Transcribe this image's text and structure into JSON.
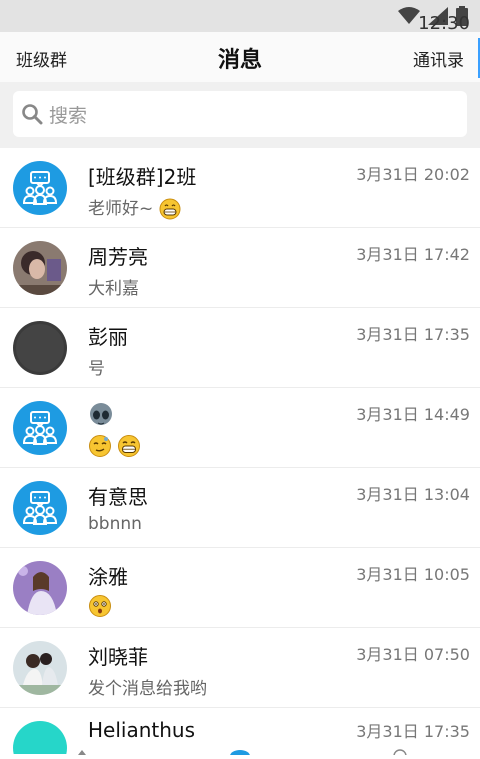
{
  "status_bar": {
    "time": "12:30"
  },
  "header": {
    "left_label": "班级群",
    "title": "消息",
    "right_label": "通讯录"
  },
  "search": {
    "placeholder": "搜索"
  },
  "conversations": [
    {
      "name": "[班级群]2班",
      "message": "老师好~",
      "time": "3月31日 20:02"
    },
    {
      "name": "周芳亮",
      "message": "大利嘉",
      "time": "3月31日 17:42"
    },
    {
      "name": "彭丽",
      "message": "号",
      "time": "3月31日 17:35"
    },
    {
      "name": "",
      "message": "",
      "time": "3月31日 14:49"
    },
    {
      "name": "有意思",
      "message": "bbnnn",
      "time": "3月31日 13:04"
    },
    {
      "name": "涂雅",
      "message": "",
      "time": "3月31日 10:05"
    },
    {
      "name": "刘晓菲",
      "message": "发个消息给我哟",
      "time": "3月31日 07:50"
    },
    {
      "name": "Helianthus",
      "message": "",
      "time": "3月31日 17:35"
    }
  ]
}
